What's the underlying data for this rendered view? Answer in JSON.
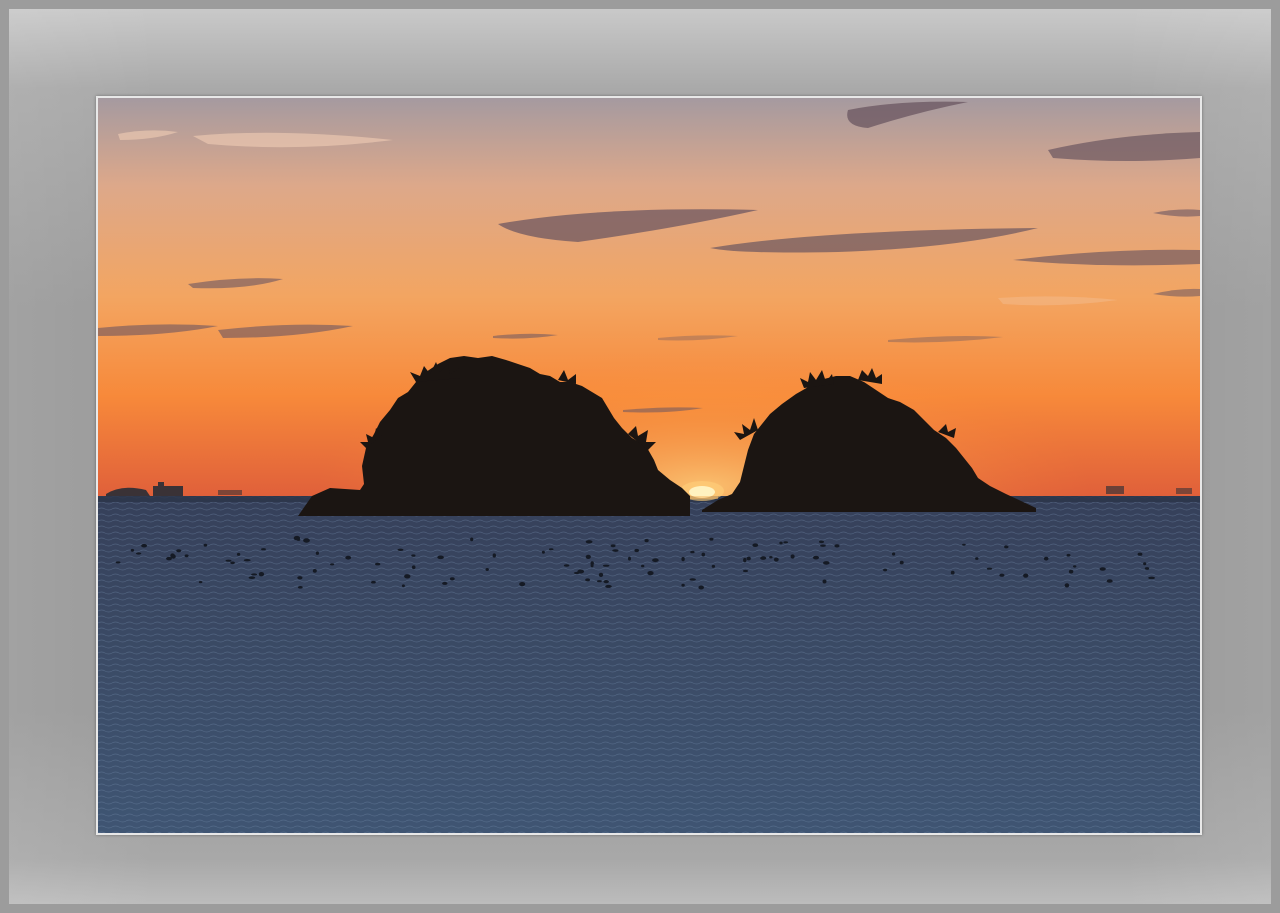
{
  "image": {
    "subject": "",
    "colors": {
      "sky_top": "#a59aa0",
      "sky_mid": "#f3a561",
      "sky_glow": "#f7893a",
      "sky_horizon": "#e0603a",
      "sun": "#fff2c0",
      "sea_top": "#36405a",
      "sea_bottom": "#3f5573",
      "island": "#1b1512",
      "cloud": "#6a5560",
      "frame_outer": "#9c9c9c",
      "mat_border": "#e8e8e8"
    }
  }
}
